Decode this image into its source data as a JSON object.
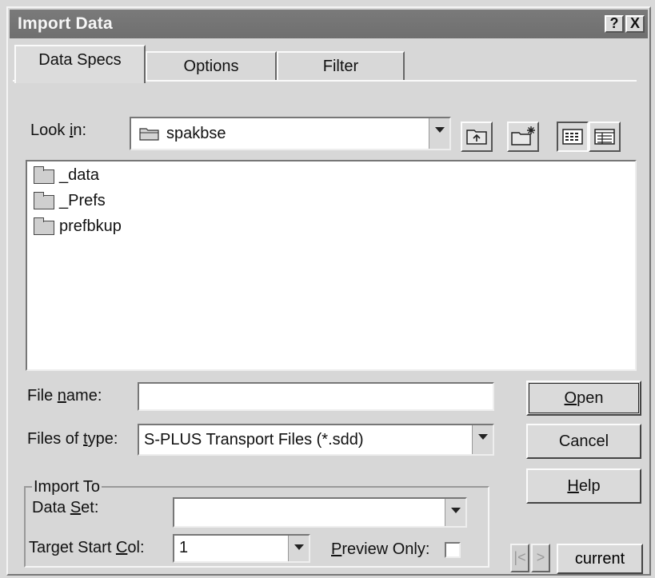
{
  "window": {
    "title": "Import Data",
    "help_glyph": "?",
    "close_glyph": "X"
  },
  "tabs": [
    {
      "label": "Data Specs",
      "active": true
    },
    {
      "label": "Options",
      "active": false
    },
    {
      "label": "Filter",
      "active": false
    }
  ],
  "look_in": {
    "label_pre": "Look ",
    "label_mnemonic": "i",
    "label_post": "n:",
    "value": "spakbse",
    "icon": "folder-icon"
  },
  "toolbar_icons": [
    "up-one-level-icon",
    "create-new-folder-icon",
    "list-view-icon",
    "details-view-icon"
  ],
  "files": [
    {
      "name": "_data",
      "icon": "folder-icon"
    },
    {
      "name": "_Prefs",
      "icon": "folder-icon"
    },
    {
      "name": "prefbkup",
      "icon": "folder-icon"
    }
  ],
  "file_name": {
    "label_pre": "File ",
    "label_mnemonic": "n",
    "label_post": "ame:",
    "value": ""
  },
  "files_of_type": {
    "label_pre": "Files of ",
    "label_mnemonic": "t",
    "label_post": "ype:",
    "value": "S-PLUS Transport Files (*.sdd)"
  },
  "buttons": {
    "open": {
      "mnemonic": "O",
      "rest": "pen"
    },
    "cancel": "Cancel",
    "help": {
      "mnemonic": "H",
      "rest": "elp"
    }
  },
  "import_to": {
    "group_label": "Import To",
    "data_set_label_pre": "Data ",
    "data_set_label_mnemonic": "S",
    "data_set_label_post": "et:",
    "data_set_value": "",
    "target_start_col_label_pre": "Target Start ",
    "target_start_col_label_mnemonic": "C",
    "target_start_col_label_post": "ol:",
    "target_start_col_value": "1",
    "preview_label_pre": "",
    "preview_label_mnemonic": "P",
    "preview_label_post": "review Only:",
    "preview_checked": false
  },
  "record_nav": {
    "first_glyph": "|<",
    "next_glyph": ">",
    "current_label": "current"
  }
}
